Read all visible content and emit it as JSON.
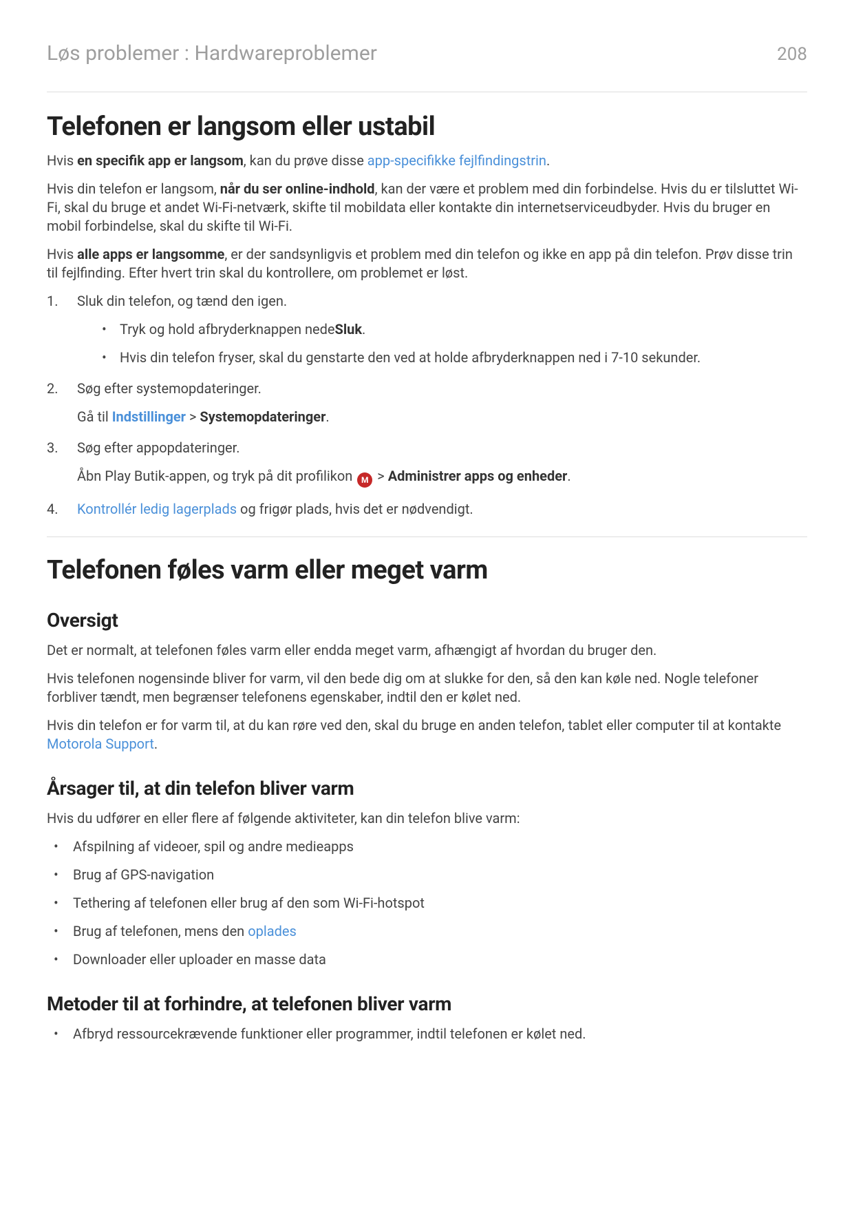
{
  "header": {
    "breadcrumb": "Løs problemer : Hardwareproblemer",
    "page_number": "208"
  },
  "section1": {
    "title": "Telefonen er langsom eller ustabil",
    "p1_a": "Hvis ",
    "p1_b_bold": "en specifik app er langsom",
    "p1_c": ", kan du prøve disse ",
    "p1_link": "app-specifikke fejlfindingstrin",
    "p1_d": ".",
    "p2_a": "Hvis din telefon er langsom, ",
    "p2_b_bold": "når du ser online-indhold",
    "p2_c": ", kan der være et problem med din forbindelse. Hvis du er tilsluttet Wi-Fi, skal du bruge et andet Wi-Fi-netværk, skifte til mobildata eller kontakte din internetserviceudbyder. Hvis du bruger en mobil forbindelse, skal du skifte til Wi-Fi.",
    "p3_a": "Hvis ",
    "p3_b_bold": "alle apps er langsomme",
    "p3_c": ", er der sandsynligvis et problem med din telefon og ikke en app på din telefon. Prøv disse trin til fejlfinding. Efter hvert trin skal du kontrollere, om problemet er løst.",
    "steps": {
      "s1_main": "Sluk din telefon, og tænd den igen.",
      "s1_b1_a": "Tryk og hold afbryderknappen nede",
      "s1_b1_b_bold": "Sluk",
      "s1_b1_c": ".",
      "s1_b2": "Hvis din telefon fryser, skal du genstarte den ved at holde afbryderknappen ned i 7-10 sekunder.",
      "s2_main": "Søg efter systemopdateringer.",
      "s2_sub_a": "Gå til ",
      "s2_sub_link": "Indstillinger",
      "s2_sub_b": " > ",
      "s2_sub_c_bold": "Systemopdateringer",
      "s2_sub_d": ".",
      "s3_main": "Søg efter appopdateringer.",
      "s3_sub_a": "Åbn Play Butik-appen, og tryk på dit profilikon ",
      "s3_icon_letter": "M",
      "s3_sub_b": " > ",
      "s3_sub_c_bold": "Administrer apps og enheder",
      "s3_sub_d": ".",
      "s4_link": "Kontrollér ledig lagerplads",
      "s4_b": " og frigør plads, hvis det er nødvendigt."
    }
  },
  "section2": {
    "title": "Telefonen føles varm eller meget varm",
    "sub1": {
      "heading": "Oversigt",
      "p1": "Det er normalt, at telefonen føles varm eller endda meget varm, afhængigt af hvordan du bruger den.",
      "p2": "Hvis telefonen nogensinde bliver for varm, vil den bede dig om at slukke for den, så den kan køle ned. Nogle telefoner forbliver tændt, men begrænser telefonens egenskaber, indtil den er kølet ned.",
      "p3_a": "Hvis din telefon er for varm til, at du kan røre ved den, skal du bruge en anden telefon, tablet eller computer til at kontakte ",
      "p3_link": "Motorola Support",
      "p3_b": "."
    },
    "sub2": {
      "heading": "Årsager til, at din telefon bliver varm",
      "p1": "Hvis du udfører en eller flere af følgende aktiviteter, kan din telefon blive varm:",
      "bullets": {
        "b1": "Afspilning af videoer, spil og andre medieapps",
        "b2": "Brug af GPS-navigation",
        "b3": "Tethering af telefonen eller brug af den som Wi-Fi-hotspot",
        "b4_a": "Brug af telefonen, mens den ",
        "b4_link": "oplades",
        "b5": "Downloader eller uploader en masse data"
      }
    },
    "sub3": {
      "heading": "Metoder til at forhindre, at telefonen bliver varm",
      "b1": "Afbryd ressourcekrævende funktioner eller programmer, indtil telefonen er kølet ned."
    }
  }
}
